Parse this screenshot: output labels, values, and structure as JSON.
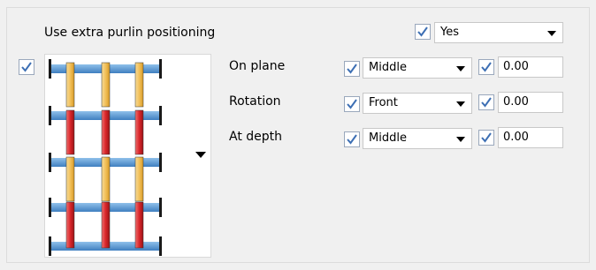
{
  "extra_purlin": {
    "label": "Use extra purlin positioning",
    "enabled": true,
    "value": "Yes"
  },
  "layout_picker": {
    "enabled": true,
    "icon": "purlin-layout-icon"
  },
  "rows": [
    {
      "label": "On plane",
      "option_enabled": true,
      "option": "Middle",
      "offset_enabled": true,
      "offset": "0.00"
    },
    {
      "label": "Rotation",
      "option_enabled": true,
      "option": "Front",
      "offset_enabled": true,
      "offset": "0.00"
    },
    {
      "label": "At depth",
      "option_enabled": true,
      "option": "Middle",
      "offset_enabled": true,
      "offset": "0.00"
    }
  ],
  "colors": {
    "checkbox_border": "#9aa8bc",
    "checkmark": "#3d6fb4",
    "purlin_blue": "#5b9bd5",
    "column_yellow": "#f2c05a",
    "column_red": "#d9262a"
  }
}
